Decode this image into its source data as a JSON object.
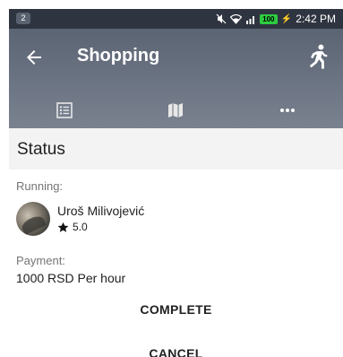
{
  "status_bar": {
    "notification_count": "2",
    "battery": "100",
    "time": "2:42 PM",
    "icons": [
      "mute-icon",
      "wifi-icon",
      "signal-icon",
      "battery-icon"
    ]
  },
  "app_bar": {
    "title": "Shopping",
    "back_icon": "arrow-left-icon",
    "action_icon": "running-person-icon",
    "tabs": [
      "list-icon",
      "map-icon",
      "more-icon"
    ],
    "colors": {
      "top": "#5b6473",
      "bottom": "#7a8290"
    }
  },
  "section": {
    "title": "Status"
  },
  "running": {
    "label": "Running:",
    "user_name": "Uroš Milivojević",
    "rating": "5.0"
  },
  "payment": {
    "label": "Payment:",
    "value": "1000 RSD Per hour"
  },
  "actions": {
    "complete": "COMPLETE",
    "cancel": "CANCEL"
  }
}
